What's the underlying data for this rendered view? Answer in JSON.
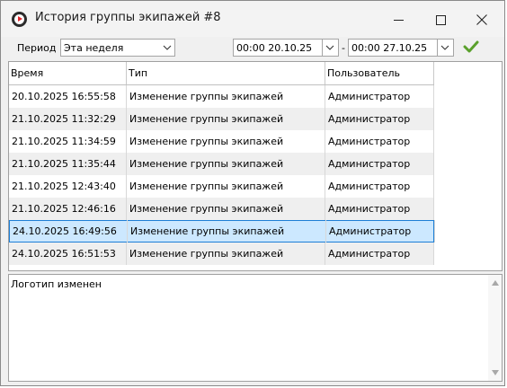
{
  "window": {
    "title": "История группы экипажей #8"
  },
  "toolbar": {
    "period_label": "Период",
    "period_value": "Эта неделя",
    "date_from": "00:00 20.10.25",
    "separator": "-",
    "date_to": "00:00 27.10.25"
  },
  "grid": {
    "columns": [
      "Время",
      "Тип",
      "Пользователь"
    ],
    "rows": [
      [
        "20.10.2025 16:55:58",
        "Изменение группы экипажей",
        "Администратор"
      ],
      [
        "21.10.2025 11:32:29",
        "Изменение группы экипажей",
        "Администратор"
      ],
      [
        "21.10.2025 11:34:59",
        "Изменение группы экипажей",
        "Администратор"
      ],
      [
        "21.10.2025 11:35:44",
        "Изменение группы экипажей",
        "Администратор"
      ],
      [
        "21.10.2025 12:43:40",
        "Изменение группы экипажей",
        "Администратор"
      ],
      [
        "21.10.2025 12:46:16",
        "Изменение группы экипажей",
        "Администратор"
      ],
      [
        "24.10.2025 16:49:56",
        "Изменение группы экипажей",
        "Администратор"
      ],
      [
        "24.10.2025 16:51:53",
        "Изменение группы экипажей",
        "Администратор"
      ]
    ],
    "selected_row": 6
  },
  "details": {
    "text": "Логотип изменен"
  },
  "icons": {
    "app": "app-logo-icon",
    "minimize": "minimize-icon",
    "maximize": "maximize-icon",
    "close": "close-icon",
    "dropdown": "chevron-down-icon",
    "apply": "checkmark-icon"
  },
  "colors": {
    "selection_fill": "#cce8ff",
    "selection_border": "#1e7fd6",
    "apply_check": "#5aa02c",
    "app_icon_red": "#e0262b"
  }
}
